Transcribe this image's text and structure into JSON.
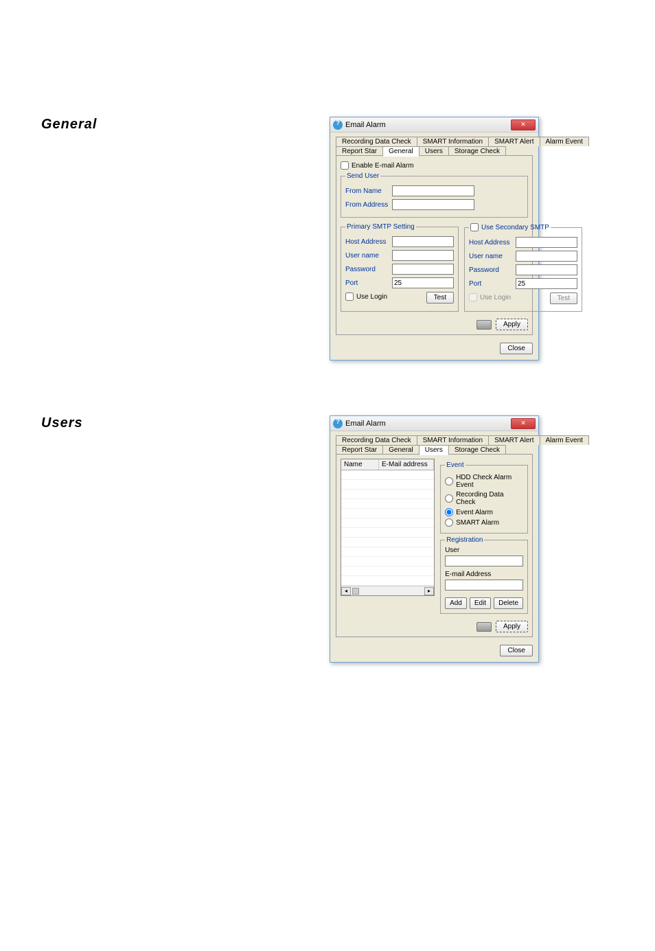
{
  "section1": {
    "title": "General"
  },
  "section2": {
    "title": "Users"
  },
  "dialog": {
    "title": "Email Alarm",
    "tabs": [
      "Recording Data Check",
      "SMART Information",
      "SMART Alert",
      "Alarm Event",
      "Report Star",
      "General",
      "Users",
      "Storage Check"
    ]
  },
  "general": {
    "enable_label": "Enable E-mail Alarm",
    "send_user_legend": "Send User",
    "from_name_label": "From Name",
    "from_address_label": "From Address",
    "primary_legend": "Primary SMTP Setting",
    "secondary_label": "Use Secondary SMTP",
    "host_label": "Host Address",
    "user_label": "User name",
    "pass_label": "Password",
    "port_label": "Port",
    "port_value": "25",
    "use_login_label": "Use Login",
    "test_label": "Test",
    "apply_label": "Apply",
    "close_label": "Close"
  },
  "users": {
    "table": {
      "col1": "Name",
      "col2": "E-Mail address"
    },
    "event_legend": "Event",
    "event_opts": [
      "HDD Check Alarm Event",
      "Recording Data Check",
      "Event Alarm",
      "SMART Alarm"
    ],
    "reg_legend": "Registration",
    "user_label": "User",
    "email_label": "E-mail Address",
    "add_label": "Add",
    "edit_label": "Edit",
    "delete_label": "Delete",
    "apply_label": "Apply",
    "close_label": "Close"
  }
}
